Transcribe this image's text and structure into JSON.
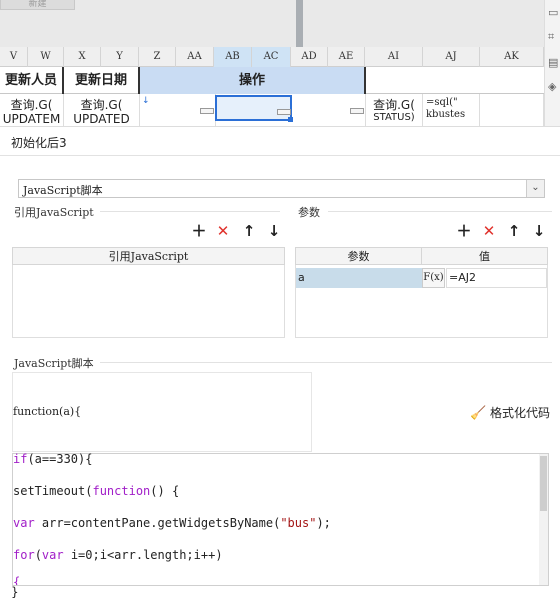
{
  "top": {
    "new_button": "新建"
  },
  "sidebar_right": {
    "icons": [
      "monitor-icon",
      "frame-icon",
      "panel-icon",
      "cube-icon"
    ]
  },
  "columns": [
    "V",
    "W",
    "X",
    "Y",
    "Z",
    "AA",
    "AB",
    "AC",
    "AD",
    "AE",
    "AI",
    "AJ",
    "AK"
  ],
  "sheet": {
    "header_row": {
      "updater": "更新人员",
      "update_date": "更新日期",
      "operation": "操作"
    },
    "data_row": {
      "cell_v": "查询.G(",
      "cell_v2": "UPDATEM",
      "cell_x": "查询.G(",
      "cell_x2": "UPDATED",
      "cell_ai": "查询.G(",
      "cell_ai2": "STATUS)",
      "cell_aj": "=sql(\"",
      "cell_aj2": "kbustes"
    }
  },
  "panel": {
    "title": "初始化后3",
    "script_type": "JavaScript脚本",
    "ref_js_section": "引用JavaScript",
    "ref_js_column": "引用JavaScript",
    "params_section": "参数",
    "params_table": {
      "columns": [
        "参数",
        "值"
      ],
      "rows": [
        {
          "name": "a",
          "fx": "F(x)",
          "value": "=AJ2"
        }
      ]
    },
    "js_section": "JavaScript脚本",
    "function_header": "function(a){",
    "format_code_label": "格式化代码",
    "closing_brace": "}",
    "code": {
      "line1_kw": "if",
      "line1_rest": "(a==330){",
      "line2_fn": "setTimeout(",
      "line2_kw": "function",
      "line2_rest": "() {",
      "line3_kw": "var",
      "line3_mid": " arr=contentPane.getWidgetsByName(",
      "line3_str": "\"bus\"",
      "line3_end": ");",
      "line4_kw1": "for",
      "line4_p1": "(",
      "line4_kw2": "var",
      "line4_rest": " i=0;i<arr.length;i++)",
      "line5": "{"
    }
  },
  "colors": {
    "accent_blue": "#2b6fd6",
    "selected_header": "#cfe3f5",
    "operation_header": "#c9dcf3",
    "param_row": "#c8dcea",
    "delete_red": "#e0322c"
  }
}
